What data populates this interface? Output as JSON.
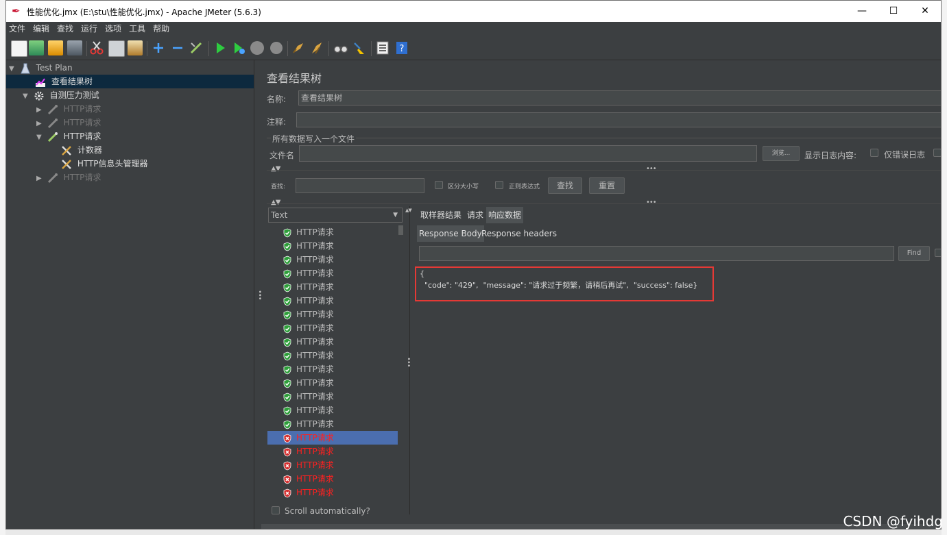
{
  "window": {
    "title": "性能优化.jmx (E:\\stu\\性能优化.jmx) - Apache JMeter (5.6.3)",
    "minimize": "—",
    "maximize": "☐",
    "close": "✕"
  },
  "menu": [
    "文件",
    "编辑",
    "查找",
    "运行",
    "选项",
    "工具",
    "帮助"
  ],
  "tree": {
    "items": [
      {
        "label": "Test Plan",
        "icon": "test-plan-icon"
      },
      {
        "label": "查看结果树",
        "icon": "view-results-tree-icon"
      },
      {
        "label": "自测压力测试",
        "icon": "thread-group-gear-icon"
      },
      {
        "label": "HTTP请求",
        "icon": "sampler-pipette-icon"
      },
      {
        "label": "HTTP请求",
        "icon": "sampler-pipette-icon"
      },
      {
        "label": "HTTP请求",
        "icon": "sampler-pipette-icon"
      },
      {
        "label": "计数器",
        "icon": "config-tools-icon"
      },
      {
        "label": "HTTP信息头管理器",
        "icon": "config-tools-icon"
      },
      {
        "label": "HTTP请求",
        "icon": "sampler-pipette-icon"
      }
    ]
  },
  "panel": {
    "title": "查看结果树",
    "name_label": "名称:",
    "name_value": "查看结果树",
    "comment_label": "注释:",
    "comment_value": "",
    "file_section_label": "所有数据写入一个文件",
    "filename_label": "文件名",
    "filename_value": "",
    "browse_label": "浏览...",
    "log_content_label": "显示日志内容:",
    "errors_only_label": "仅错误日志",
    "search_label": "查找:",
    "search_value": "",
    "case_sensitive_label": "区分大小写",
    "regex_label": "正则表达式",
    "find_button": "查找",
    "reset_button": "重置"
  },
  "results": {
    "renderer": "Text",
    "items": [
      {
        "label": "HTTP请求",
        "status": "success"
      },
      {
        "label": "HTTP请求",
        "status": "success"
      },
      {
        "label": "HTTP请求",
        "status": "success"
      },
      {
        "label": "HTTP请求",
        "status": "success"
      },
      {
        "label": "HTTP请求",
        "status": "success"
      },
      {
        "label": "HTTP请求",
        "status": "success"
      },
      {
        "label": "HTTP请求",
        "status": "success"
      },
      {
        "label": "HTTP请求",
        "status": "success"
      },
      {
        "label": "HTTP请求",
        "status": "success"
      },
      {
        "label": "HTTP请求",
        "status": "success"
      },
      {
        "label": "HTTP请求",
        "status": "success"
      },
      {
        "label": "HTTP请求",
        "status": "success"
      },
      {
        "label": "HTTP请求",
        "status": "success"
      },
      {
        "label": "HTTP请求",
        "status": "success"
      },
      {
        "label": "HTTP请求",
        "status": "success"
      },
      {
        "label": "HTTP请求",
        "status": "fail",
        "selected": true
      },
      {
        "label": "HTTP请求",
        "status": "fail"
      },
      {
        "label": "HTTP请求",
        "status": "fail"
      },
      {
        "label": "HTTP请求",
        "status": "fail"
      },
      {
        "label": "HTTP请求",
        "status": "fail"
      }
    ],
    "scroll_auto_label": "Scroll automatically?"
  },
  "detail": {
    "tabs": [
      "取样器结果",
      "请求",
      "响应数据"
    ],
    "subtabs": [
      "Response Body",
      "Response headers"
    ],
    "find_label": "Find",
    "response_line1": "{",
    "response_line2": "  \"code\": \"429\",  \"message\": \"请求过于频繁，请稍后再试\",  \"success\": false}"
  },
  "watermark": "CSDN @fyihdg",
  "colors": {
    "background": "#3c3f41",
    "selected_tree": "#0d293e",
    "selected_result": "#4b6eaf",
    "error_text": "#ff2020",
    "highlight_box": "#e53935"
  }
}
